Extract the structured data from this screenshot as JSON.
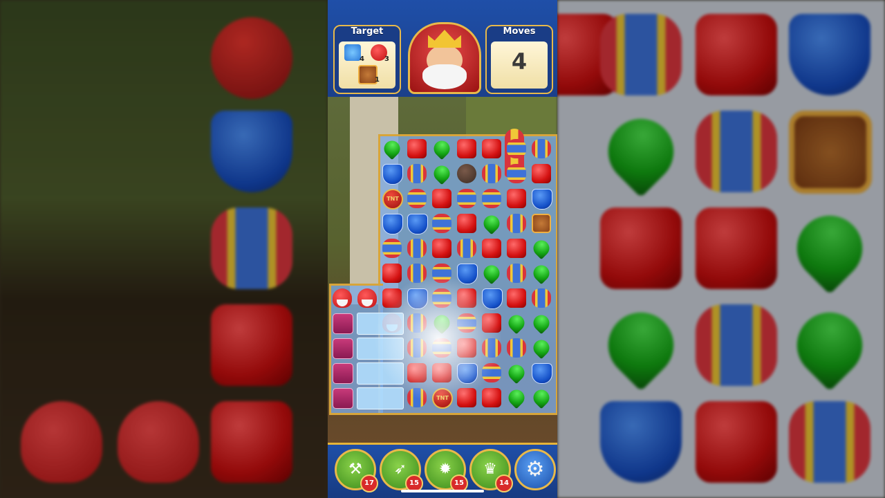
{
  "header": {
    "target_label": "Target",
    "moves_label": "Moves",
    "moves_value": "4",
    "targets": [
      {
        "icon": "ice-block-icon",
        "count": "4"
      },
      {
        "icon": "bird-icon",
        "count": "3"
      },
      {
        "icon": "crate-icon",
        "count": "1"
      }
    ]
  },
  "boosters": [
    {
      "icon": "hammer-booster-icon",
      "count": "17"
    },
    {
      "icon": "arrow-booster-icon",
      "count": "15"
    },
    {
      "icon": "cannon-booster-icon",
      "count": "15"
    },
    {
      "icon": "jester-booster-icon",
      "count": "14"
    }
  ],
  "settings_icon": "gear-icon",
  "board_tnt_label": "TNT",
  "colors": {
    "accent_gold": "#e6b438",
    "header_blue": "#1f4fa8"
  }
}
